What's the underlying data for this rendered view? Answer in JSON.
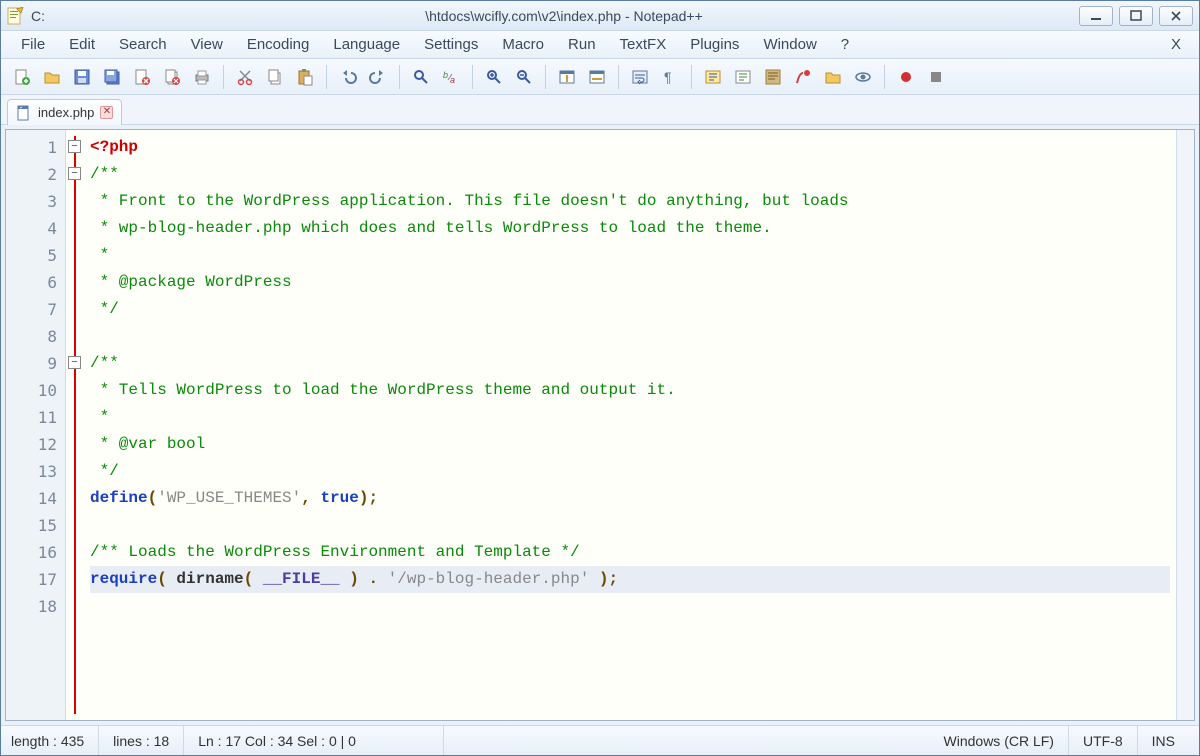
{
  "title": {
    "prefix": "C:",
    "path": "\\htdocs\\wcifly.com\\v2\\index.php - Notepad++"
  },
  "menus": [
    "File",
    "Edit",
    "Search",
    "View",
    "Encoding",
    "Language",
    "Settings",
    "Macro",
    "Run",
    "TextFX",
    "Plugins",
    "Window",
    "?"
  ],
  "menu_close": "X",
  "toolbar_icons": [
    "new-icon",
    "open-icon",
    "save-icon",
    "save-all-icon",
    "close-icon",
    "close-all-icon",
    "print-icon",
    "sep",
    "cut-icon",
    "copy-icon",
    "paste-icon",
    "sep",
    "undo-icon",
    "redo-icon",
    "sep",
    "find-icon",
    "replace-icon",
    "sep",
    "zoom-in-icon",
    "zoom-out-icon",
    "sep",
    "sync-v-icon",
    "sync-h-icon",
    "sep",
    "wordwrap-icon",
    "show-all-icon",
    "sep",
    "indent-guide-icon",
    "lang-icon",
    "doc-map-icon",
    "function-list-icon",
    "folder-icon",
    "monitor-icon",
    "sep",
    "record-icon",
    "stop-icon"
  ],
  "tab": {
    "label": "index.php"
  },
  "code_lines": [
    {
      "n": 1,
      "fold": "box-minus",
      "segs": [
        [
          "tok-tag",
          "<?php"
        ]
      ]
    },
    {
      "n": 2,
      "fold": "box-minus",
      "segs": [
        [
          "tok-comment",
          "/**"
        ]
      ]
    },
    {
      "n": 3,
      "segs": [
        [
          "tok-comment",
          " * Front to the WordPress application. This file doesn't do anything, but loads"
        ]
      ]
    },
    {
      "n": 4,
      "segs": [
        [
          "tok-comment",
          " * wp-blog-header.php which does and tells WordPress to load the theme."
        ]
      ]
    },
    {
      "n": 5,
      "segs": [
        [
          "tok-comment",
          " *"
        ]
      ]
    },
    {
      "n": 6,
      "segs": [
        [
          "tok-comment",
          " * @package WordPress"
        ]
      ]
    },
    {
      "n": 7,
      "segs": [
        [
          "tok-comment",
          " */"
        ]
      ]
    },
    {
      "n": 8,
      "segs": [
        [
          "",
          ""
        ]
      ]
    },
    {
      "n": 9,
      "fold": "box-minus",
      "segs": [
        [
          "tok-comment",
          "/**"
        ]
      ]
    },
    {
      "n": 10,
      "segs": [
        [
          "tok-comment",
          " * Tells WordPress to load the WordPress theme and output it."
        ]
      ]
    },
    {
      "n": 11,
      "segs": [
        [
          "tok-comment",
          " *"
        ]
      ]
    },
    {
      "n": 12,
      "segs": [
        [
          "tok-comment",
          " * @var bool"
        ]
      ]
    },
    {
      "n": 13,
      "segs": [
        [
          "tok-comment",
          " */"
        ]
      ]
    },
    {
      "n": 14,
      "segs": [
        [
          "tok-keyword",
          "define"
        ],
        [
          "tok-punc",
          "("
        ],
        [
          "tok-string",
          "'WP_USE_THEMES'"
        ],
        [
          "tok-punc",
          ", "
        ],
        [
          "tok-keyword",
          "true"
        ],
        [
          "tok-punc",
          ");"
        ]
      ]
    },
    {
      "n": 15,
      "segs": [
        [
          "",
          ""
        ]
      ]
    },
    {
      "n": 16,
      "segs": [
        [
          "tok-comment",
          "/** Loads the WordPress Environment and Template */"
        ]
      ]
    },
    {
      "n": 17,
      "hl": true,
      "segs": [
        [
          "tok-keyword",
          "require"
        ],
        [
          "tok-punc",
          "( "
        ],
        [
          "tok-func",
          "dirname"
        ],
        [
          "tok-punc",
          "( "
        ],
        [
          "tok-const",
          "__FILE__"
        ],
        [
          "tok-punc",
          " ) . "
        ],
        [
          "tok-string",
          "'/wp-blog-header.php'"
        ],
        [
          "tok-punc",
          " );"
        ]
      ]
    },
    {
      "n": 18,
      "segs": [
        [
          "",
          ""
        ]
      ]
    }
  ],
  "status": {
    "length": "length : 435",
    "lines": "lines : 18",
    "pos": "Ln : 17    Col : 34    Sel : 0 | 0",
    "eol": "Windows (CR LF)",
    "enc": "UTF-8",
    "ovr": "INS"
  }
}
